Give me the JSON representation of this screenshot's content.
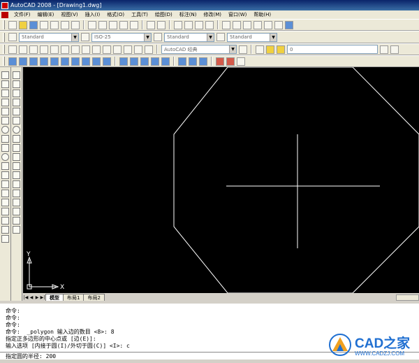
{
  "window": {
    "title": "AutoCAD 2008 - [Drawing1.dwg]"
  },
  "menu": [
    "文件(F)",
    "编辑(E)",
    "视图(V)",
    "插入(I)",
    "格式(O)",
    "工具(T)",
    "绘图(D)",
    "标注(N)",
    "修改(M)",
    "窗口(W)",
    "帮助(H)"
  ],
  "styles": {
    "text_style": "Standard",
    "dim_style": "ISO-25",
    "table_style": "Standard",
    "mleader_style": "Standard"
  },
  "workspace": "AutoCAD 经典",
  "layer": "0",
  "layout_tabs": [
    "模型",
    "布局1",
    "布局2"
  ],
  "ucs": {
    "x_label": "X",
    "y_label": "Y"
  },
  "command_history": [
    "命令:",
    "命令:",
    "命令:",
    "命令:  _polygon 输入边的数目 <8>: 8",
    "指定正多边形的中心点或 [边(E)]:",
    "输入选项 [内接于圆(I)/外切于圆(C)] <I>: c"
  ],
  "command_prompt": "指定圆的半径: 200",
  "watermark": {
    "brand": "CAD之家",
    "url": "WWW.CADZJ.COM"
  },
  "colors": {
    "canvas_bg": "#000000",
    "geometry": "#ffffff",
    "brand": "#1f6fd1"
  }
}
